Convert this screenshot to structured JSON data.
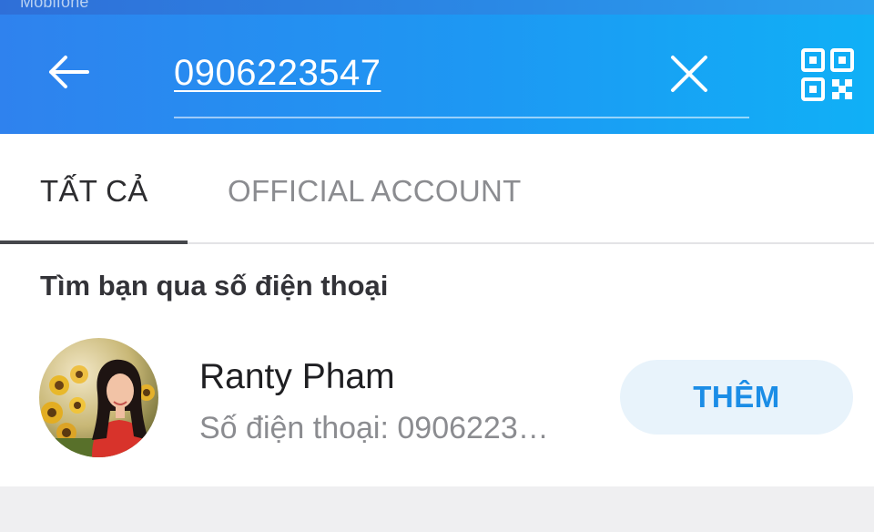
{
  "status_bar": {
    "carrier": "Mobifone"
  },
  "search": {
    "value": "0906223547",
    "back_icon": "arrow-left-icon",
    "clear_icon": "close-icon",
    "qr_icon": "qr-code-icon"
  },
  "tabs": [
    {
      "label": "TẤT CẢ",
      "active": true
    },
    {
      "label": "OFFICIAL ACCOUNT",
      "active": false
    }
  ],
  "results": {
    "section_title": "Tìm bạn qua số điện thoại",
    "contact": {
      "name": "Ranty Pham",
      "phone_text": "Số điện thoại: 0906223…",
      "add_label": "THÊM"
    }
  },
  "colors": {
    "header_start": "#2f82ee",
    "header_end": "#10b0f6",
    "accent": "#1b8de6",
    "add_button_bg": "#e8f3fb"
  }
}
